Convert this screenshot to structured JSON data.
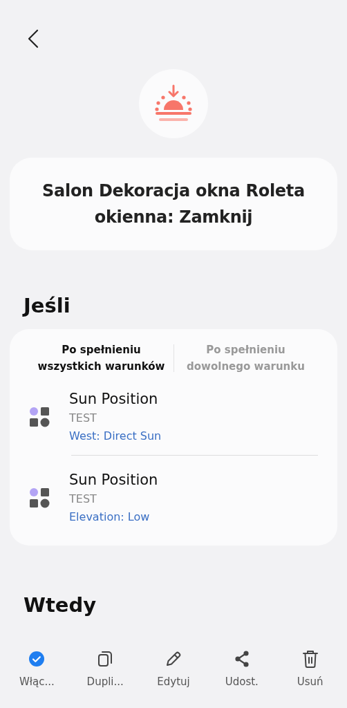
{
  "title": "Salon Dekoracja okna Roleta okienna: Zamknij",
  "if_section": {
    "heading": "Jeśli",
    "tabs": [
      {
        "label": "Po spełnieniu wszystkich warunków",
        "selected": true
      },
      {
        "label": "Po spełnieniu dowolnego warunku",
        "selected": false
      }
    ],
    "conditions": [
      {
        "name": "Sun Position",
        "device": "TEST",
        "value": "West: Direct Sun"
      },
      {
        "name": "Sun Position",
        "device": "TEST",
        "value": "Elevation: Low"
      }
    ]
  },
  "then_section": {
    "heading": "Wtedy"
  },
  "bottom_bar": [
    {
      "kind": "toggle",
      "label": "Włąc...",
      "checked": true
    },
    {
      "kind": "duplicate",
      "label": "Dupli..."
    },
    {
      "kind": "edit",
      "label": "Edytuj"
    },
    {
      "kind": "share",
      "label": "Udost."
    },
    {
      "kind": "delete",
      "label": "Usuń"
    }
  ]
}
